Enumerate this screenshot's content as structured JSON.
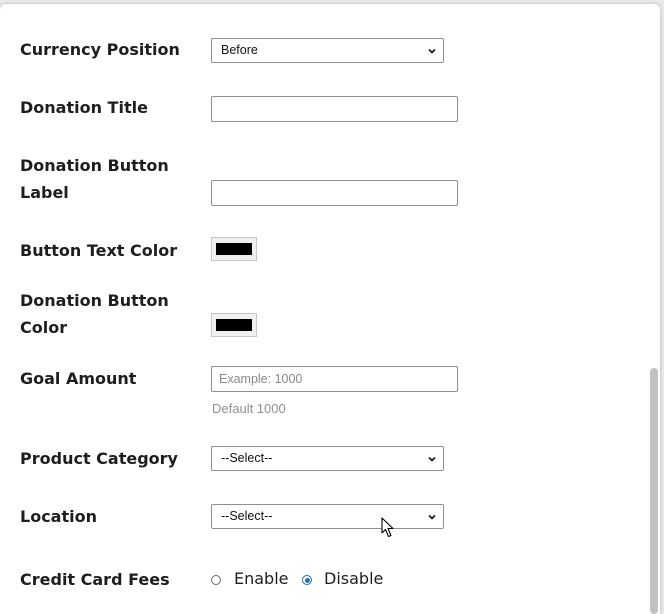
{
  "form": {
    "currency_position": {
      "label": "Currency Position",
      "selected": "Before"
    },
    "donation_title": {
      "label": "Donation Title",
      "value": ""
    },
    "donation_button_label": {
      "label_line1": "Donation Button",
      "label_line2": "Label",
      "value": ""
    },
    "button_text_color": {
      "label": "Button Text Color",
      "color": "#000000"
    },
    "donation_button_color": {
      "label_line1": "Donation Button",
      "label_line2": "Color",
      "color": "#000000"
    },
    "goal_amount": {
      "label": "Goal Amount",
      "placeholder": "Example: 1000",
      "hint": "Default 1000"
    },
    "product_category": {
      "label": "Product Category",
      "selected": "--Select--"
    },
    "location": {
      "label": "Location",
      "selected": "--Select--"
    },
    "credit_card_fees": {
      "label": "Credit Card Fees",
      "option_enable": "Enable",
      "option_disable": "Disable",
      "selected": "Disable"
    }
  },
  "colors": {
    "accent": "#2271b1",
    "label_text": "#1e1e1e",
    "hint_text": "#909090"
  }
}
